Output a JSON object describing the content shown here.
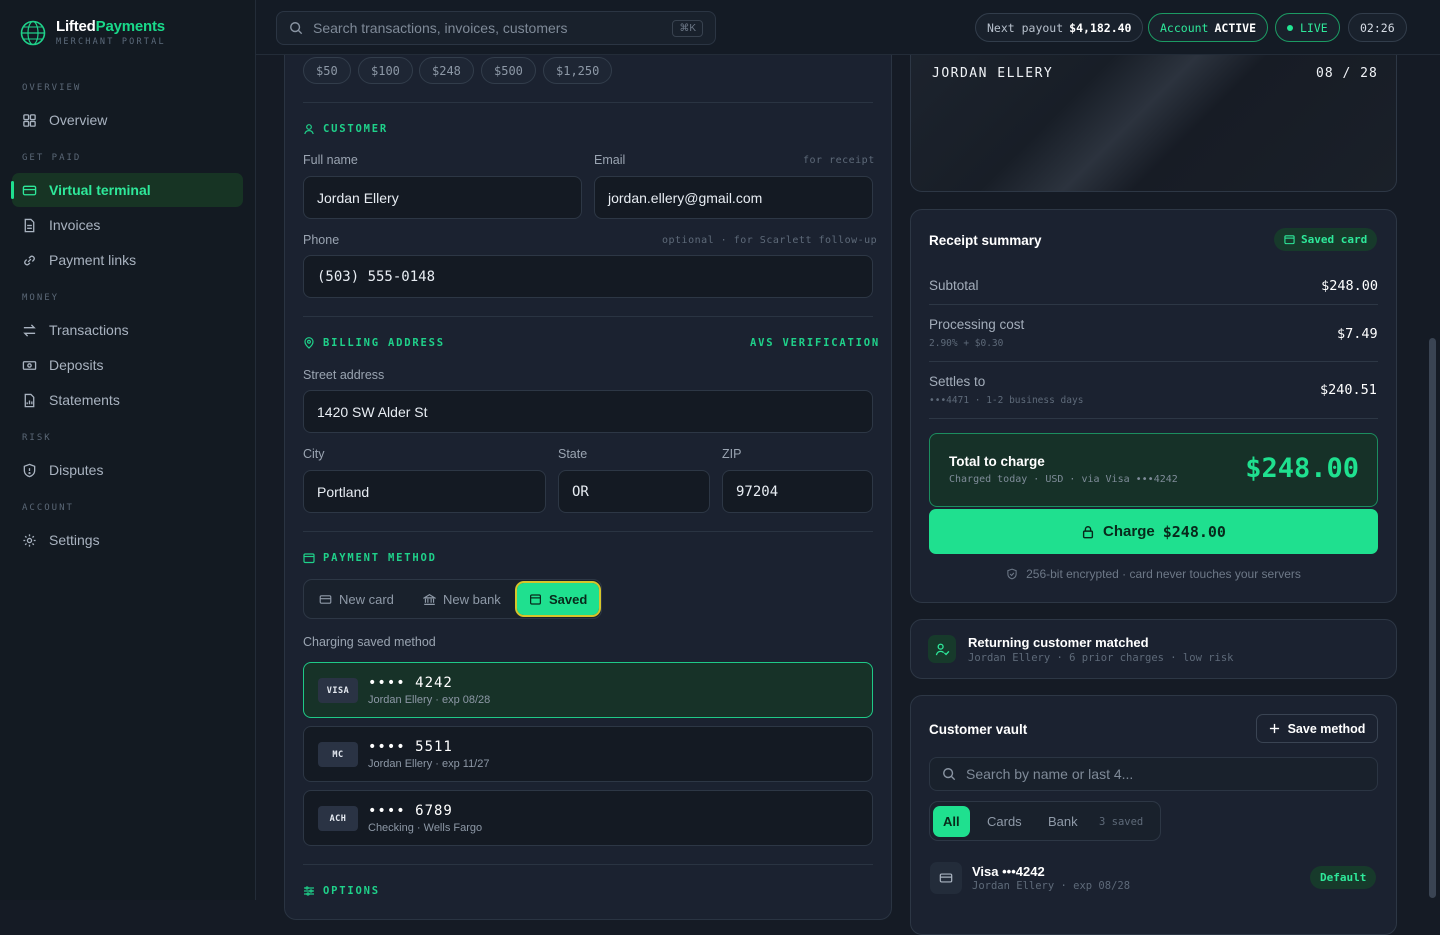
{
  "brand": {
    "name_a": "Lifted",
    "name_b": "Payments",
    "sub": "MERCHANT PORTAL"
  },
  "nav": {
    "sections": [
      {
        "label": "OVERVIEW"
      },
      {
        "label": "GET PAID"
      },
      {
        "label": "MONEY"
      },
      {
        "label": "RISK"
      },
      {
        "label": "ACCOUNT"
      }
    ],
    "items": [
      {
        "label": "Overview",
        "icon": "grid-icon"
      },
      {
        "label": "Virtual terminal",
        "icon": "card-icon",
        "active": true
      },
      {
        "label": "Invoices",
        "icon": "document-icon"
      },
      {
        "label": "Payment links",
        "icon": "link-icon"
      },
      {
        "label": "Transactions",
        "icon": "swap-icon"
      },
      {
        "label": "Deposits",
        "icon": "bank-note-icon"
      },
      {
        "label": "Statements",
        "icon": "statement-icon"
      },
      {
        "label": "Disputes",
        "icon": "shield-icon"
      },
      {
        "label": "Settings",
        "icon": "gear-icon"
      }
    ]
  },
  "topbar": {
    "search_placeholder": "Search transactions, invoices, customers",
    "kbd": "⌘K",
    "payout_label": "Next payout",
    "payout_value": "$4,182.40",
    "account_label": "Account",
    "account_value": "ACTIVE",
    "live": "LIVE",
    "time": "02:26"
  },
  "amount_chips": [
    "$50",
    "$100",
    "$248",
    "$500",
    "$1,250"
  ],
  "customer": {
    "heading": "CUSTOMER",
    "name_label": "Full name",
    "name_value": "Jordan Ellery",
    "email_label": "Email",
    "email_hint": "for receipt",
    "email_value": "jordan.ellery@gmail.com",
    "phone_label": "Phone",
    "phone_hint": "optional · for Scarlett follow-up",
    "phone_value": "(503) 555-0148"
  },
  "billing": {
    "heading": "BILLING ADDRESS",
    "avs": "AVS VERIFICATION",
    "street_label": "Street address",
    "street_value": "1420 SW Alder St",
    "city_label": "City",
    "city_value": "Portland",
    "state_label": "State",
    "state_value": "OR",
    "zip_label": "ZIP",
    "zip_value": "97204"
  },
  "payment": {
    "heading": "PAYMENT METHOD",
    "tabs": [
      "New card",
      "New bank",
      "Saved"
    ],
    "charging_label": "Charging saved method",
    "methods": [
      {
        "brand": "VISA",
        "num": "•••• 4242",
        "sub": "Jordan Ellery · exp 08/28"
      },
      {
        "brand": "MC",
        "num": "•••• 5511",
        "sub": "Jordan Ellery · exp 11/27"
      },
      {
        "brand": "ACH",
        "num": "•••• 6789",
        "sub": "Checking · Wells Fargo"
      }
    ]
  },
  "options": {
    "heading": "OPTIONS"
  },
  "card_visual": {
    "holder": "JORDAN ELLERY",
    "expiry": "08 / 28"
  },
  "receipt": {
    "title": "Receipt summary",
    "badge": "Saved card",
    "subtotal_label": "Subtotal",
    "subtotal": "$248.00",
    "proc_label": "Processing cost",
    "proc_sub": "2.90% + $0.30",
    "proc": "$7.49",
    "settle_label": "Settles to",
    "settle_sub": "•••4471 · 1-2 business days",
    "settle": "$240.51",
    "total_label": "Total to charge",
    "total_sub": "Charged today · USD · via Visa •••4242",
    "total": "$248.00",
    "charge_label": "Charge",
    "charge_amount": "$248.00",
    "secure": "256-bit encrypted · card never touches your servers"
  },
  "match": {
    "title": "Returning customer matched",
    "sub": "Jordan Ellery · 6 prior charges · low risk"
  },
  "vault": {
    "title": "Customer vault",
    "save_label": "Save method",
    "search_placeholder": "Search by name or last 4...",
    "tabs": [
      "All",
      "Cards",
      "Bank"
    ],
    "count": "3 saved",
    "item_name": "Visa •••4242",
    "item_sub": "Jordan Ellery · exp 08/28",
    "item_badge": "Default"
  },
  "colors": {
    "accent": "#1fe08f",
    "bg": "#151b25",
    "panel": "#1b2230"
  }
}
